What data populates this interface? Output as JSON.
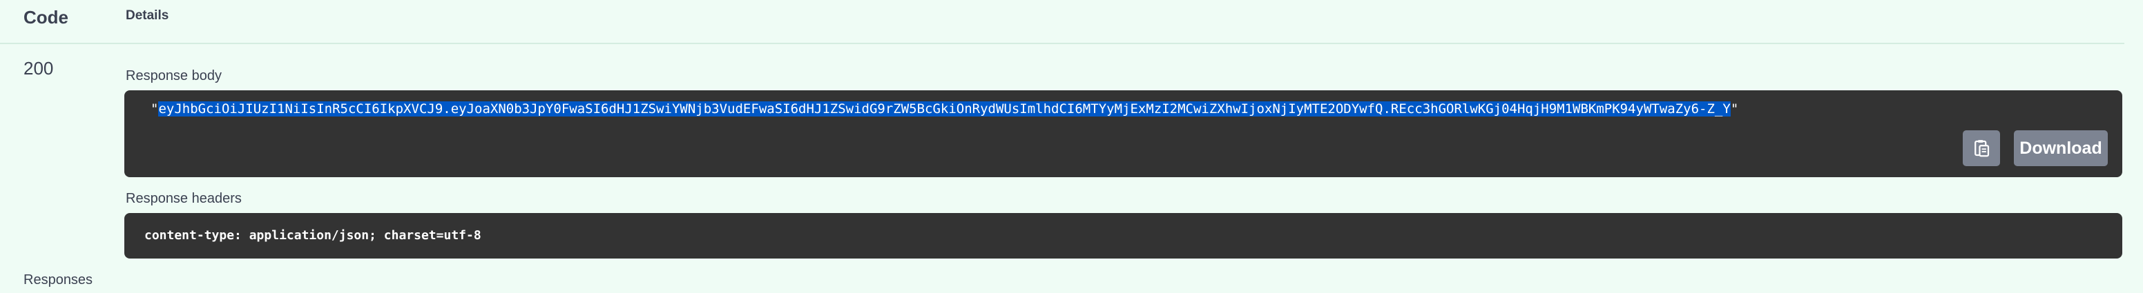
{
  "table": {
    "code_header": "Code",
    "details_header": "Details"
  },
  "response": {
    "status_code": "200",
    "body_label": "Response body",
    "body_quote_open": "\"",
    "body_token": "eyJhbGciOiJIUzI1NiIsInR5cCI6IkpXVCJ9.eyJoaXN0b3JpY0FwaSI6dHJ1ZSwiYWNjb3VudEFwaSI6dHJ1ZSwidG9rZW5BcGkiOnRydWUsImlhdCI6MTYyMjExMzI2MCwiZXhwIjoxNjIyMTE2ODYwfQ.REcc3hGORlwKGj04HqjH9M1WBKmPK94yWTwaZy6-Z_Y",
    "body_quote_close": "\"",
    "headers_label": "Response headers",
    "headers_text": "content-type: application/json; charset=utf-8",
    "download_label": "Download",
    "copy_icon": "clipboard-copy-icon"
  },
  "footer": {
    "responses_label": "Responses"
  },
  "colors": {
    "background": "#effcf5",
    "code_block": "#333333",
    "selection": "#0058c7",
    "button": "#7d8492"
  }
}
